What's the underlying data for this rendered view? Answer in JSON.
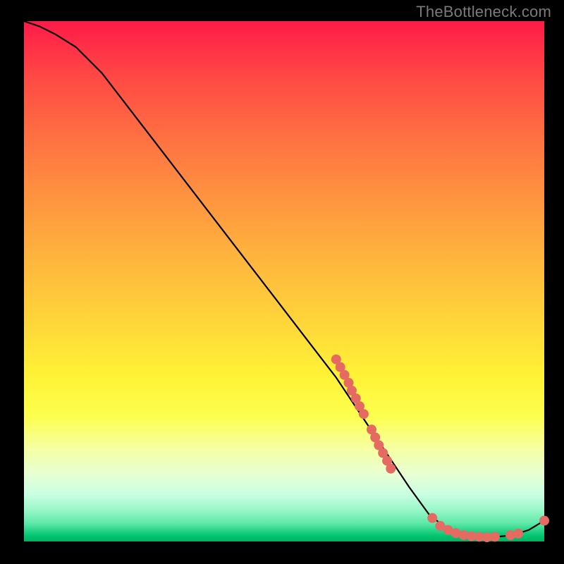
{
  "watermark": "TheBottleneck.com",
  "colors": {
    "dot_fill": "#e46a62",
    "dot_stroke": "#e46a62",
    "curve": "#000000"
  },
  "chart_data": {
    "type": "line",
    "title": "",
    "xlabel": "",
    "ylabel": "",
    "xlim": [
      0,
      100
    ],
    "ylim": [
      0,
      100
    ],
    "grid": false,
    "series": [
      {
        "name": "bottleneck-curve",
        "x": [
          0,
          3,
          6,
          10,
          15,
          20,
          25,
          30,
          35,
          40,
          45,
          50,
          55,
          60,
          63,
          66,
          70,
          74,
          78,
          82,
          86,
          90,
          94,
          97,
          100
        ],
        "y": [
          100,
          99,
          97.5,
          95,
          90,
          83.5,
          77,
          70.5,
          64,
          57.5,
          51,
          44.5,
          38,
          31.5,
          27,
          22.5,
          16.5,
          10.5,
          5,
          2,
          1,
          0.8,
          1.2,
          2.2,
          4
        ]
      }
    ],
    "dots": [
      {
        "x": 60.0,
        "y": 35.0
      },
      {
        "x": 60.8,
        "y": 33.5
      },
      {
        "x": 61.6,
        "y": 32.0
      },
      {
        "x": 62.4,
        "y": 30.5
      },
      {
        "x": 63.0,
        "y": 29.0
      },
      {
        "x": 63.8,
        "y": 27.5
      },
      {
        "x": 64.5,
        "y": 26.0
      },
      {
        "x": 65.3,
        "y": 24.5
      },
      {
        "x": 66.8,
        "y": 21.5
      },
      {
        "x": 67.5,
        "y": 20.0
      },
      {
        "x": 68.2,
        "y": 18.5
      },
      {
        "x": 69.0,
        "y": 17.0
      },
      {
        "x": 69.8,
        "y": 15.5
      },
      {
        "x": 70.5,
        "y": 14.0
      },
      {
        "x": 78.5,
        "y": 4.5
      },
      {
        "x": 80.0,
        "y": 3.0
      },
      {
        "x": 81.5,
        "y": 2.2
      },
      {
        "x": 83.0,
        "y": 1.6
      },
      {
        "x": 84.5,
        "y": 1.2
      },
      {
        "x": 86.0,
        "y": 1.0
      },
      {
        "x": 87.5,
        "y": 0.9
      },
      {
        "x": 89.0,
        "y": 0.8
      },
      {
        "x": 90.5,
        "y": 0.9
      },
      {
        "x": 93.5,
        "y": 1.2
      },
      {
        "x": 95.0,
        "y": 1.5
      },
      {
        "x": 100.0,
        "y": 4.0
      }
    ]
  }
}
